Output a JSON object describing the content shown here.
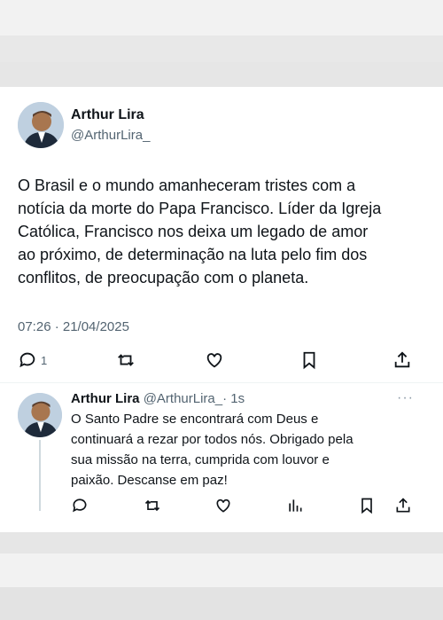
{
  "tweet": {
    "author_name": "Arthur Lira",
    "author_handle": "@ArthurLira_",
    "text": "O Brasil e o mundo amanheceram tristes com a\nnotícia da morte do Papa Francisco. Líder da Igreja\nCatólica, Francisco nos deixa um legado de amor\nao próximo, de determinação na luta pelo fim dos\nconflitos, de preocupação com o planeta.",
    "timestamp": "07:26 · 21/04/2025",
    "reply_count": "1"
  },
  "reply": {
    "author_name": "Arthur Lira",
    "author_handle": "@ArthurLira_",
    "time": "· 1s",
    "more": "···",
    "text": "O Santo Padre se encontrará com Deus e\ncontinuará a rezar por todos nós. Obrigado pela\nsua missão na terra, cumprida com louvor e\npaixão. Descanse em paz!"
  },
  "icons": {
    "main_actions": [
      "reply-icon",
      "retweet-icon",
      "like-icon",
      "bookmark-icon",
      "share-icon"
    ],
    "reply_actions": [
      "reply-icon",
      "retweet-icon",
      "like-icon",
      "views-icon",
      "bookmark-icon",
      "share-icon"
    ]
  },
  "colors": {
    "text": "#0f1419",
    "secondary": "#536471",
    "background": "#ffffff",
    "page_bands": "#e6e6e6"
  }
}
